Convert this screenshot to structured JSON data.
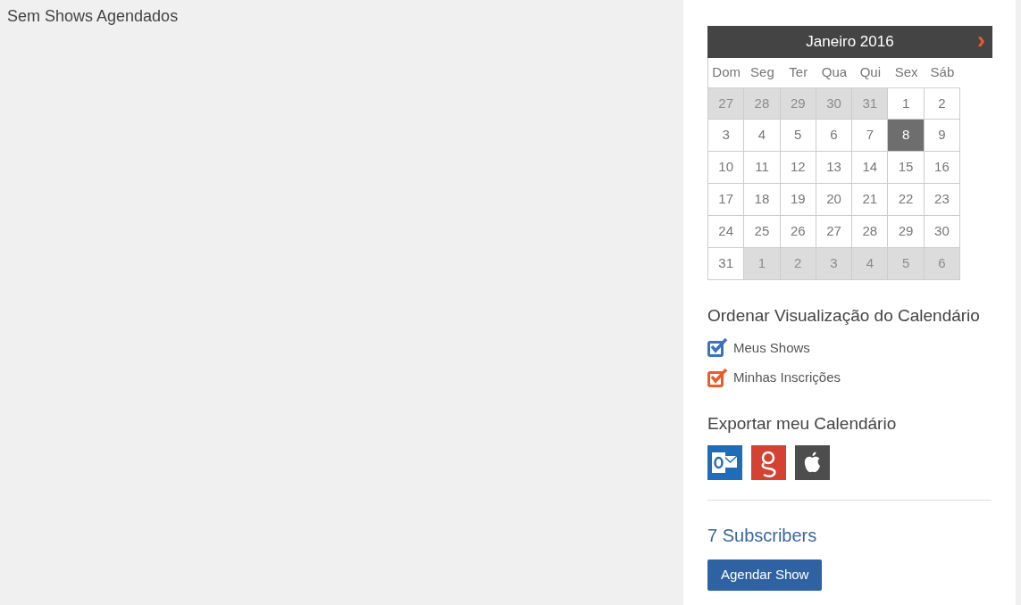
{
  "main": {
    "message": "Sem Shows Agendados"
  },
  "calendar": {
    "title": "Janeiro 2016",
    "next": "›",
    "weekdays": [
      "Dom",
      "Seg",
      "Ter",
      "Qua",
      "Qui",
      "Sex",
      "Sáb"
    ],
    "weeks": [
      [
        {
          "day": "27",
          "muted": true,
          "selected": false
        },
        {
          "day": "28",
          "muted": true,
          "selected": false
        },
        {
          "day": "29",
          "muted": true,
          "selected": false
        },
        {
          "day": "30",
          "muted": true,
          "selected": false
        },
        {
          "day": "31",
          "muted": true,
          "selected": false
        },
        {
          "day": "1",
          "muted": false,
          "selected": false
        },
        {
          "day": "2",
          "muted": false,
          "selected": false
        }
      ],
      [
        {
          "day": "3",
          "muted": false,
          "selected": false
        },
        {
          "day": "4",
          "muted": false,
          "selected": false
        },
        {
          "day": "5",
          "muted": false,
          "selected": false
        },
        {
          "day": "6",
          "muted": false,
          "selected": false
        },
        {
          "day": "7",
          "muted": false,
          "selected": false
        },
        {
          "day": "8",
          "muted": false,
          "selected": true
        },
        {
          "day": "9",
          "muted": false,
          "selected": false
        }
      ],
      [
        {
          "day": "10",
          "muted": false,
          "selected": false
        },
        {
          "day": "11",
          "muted": false,
          "selected": false
        },
        {
          "day": "12",
          "muted": false,
          "selected": false
        },
        {
          "day": "13",
          "muted": false,
          "selected": false
        },
        {
          "day": "14",
          "muted": false,
          "selected": false
        },
        {
          "day": "15",
          "muted": false,
          "selected": false
        },
        {
          "day": "16",
          "muted": false,
          "selected": false
        }
      ],
      [
        {
          "day": "17",
          "muted": false,
          "selected": false
        },
        {
          "day": "18",
          "muted": false,
          "selected": false
        },
        {
          "day": "19",
          "muted": false,
          "selected": false
        },
        {
          "day": "20",
          "muted": false,
          "selected": false
        },
        {
          "day": "21",
          "muted": false,
          "selected": false
        },
        {
          "day": "22",
          "muted": false,
          "selected": false
        },
        {
          "day": "23",
          "muted": false,
          "selected": false
        }
      ],
      [
        {
          "day": "24",
          "muted": false,
          "selected": false
        },
        {
          "day": "25",
          "muted": false,
          "selected": false
        },
        {
          "day": "26",
          "muted": false,
          "selected": false
        },
        {
          "day": "27",
          "muted": false,
          "selected": false
        },
        {
          "day": "28",
          "muted": false,
          "selected": false
        },
        {
          "day": "29",
          "muted": false,
          "selected": false
        },
        {
          "day": "30",
          "muted": false,
          "selected": false
        }
      ],
      [
        {
          "day": "31",
          "muted": false,
          "selected": false
        },
        {
          "day": "1",
          "muted": true,
          "selected": false
        },
        {
          "day": "2",
          "muted": true,
          "selected": false
        },
        {
          "day": "3",
          "muted": true,
          "selected": false
        },
        {
          "day": "4",
          "muted": true,
          "selected": false
        },
        {
          "day": "5",
          "muted": true,
          "selected": false
        },
        {
          "day": "6",
          "muted": true,
          "selected": false
        }
      ]
    ]
  },
  "view_options": {
    "heading": "Ordenar Visualização do Calendário",
    "items": [
      {
        "label": "Meus Shows",
        "checked": true,
        "color": "#3a72c0"
      },
      {
        "label": "Minhas Inscrições",
        "checked": true,
        "color": "#f05a28"
      }
    ]
  },
  "export": {
    "heading": "Exportar meu Calendário",
    "services": [
      {
        "kind": "outlook"
      },
      {
        "kind": "google"
      },
      {
        "kind": "apple"
      }
    ]
  },
  "subscribers": "7 Subscribers",
  "schedule_button": "Agendar Show"
}
